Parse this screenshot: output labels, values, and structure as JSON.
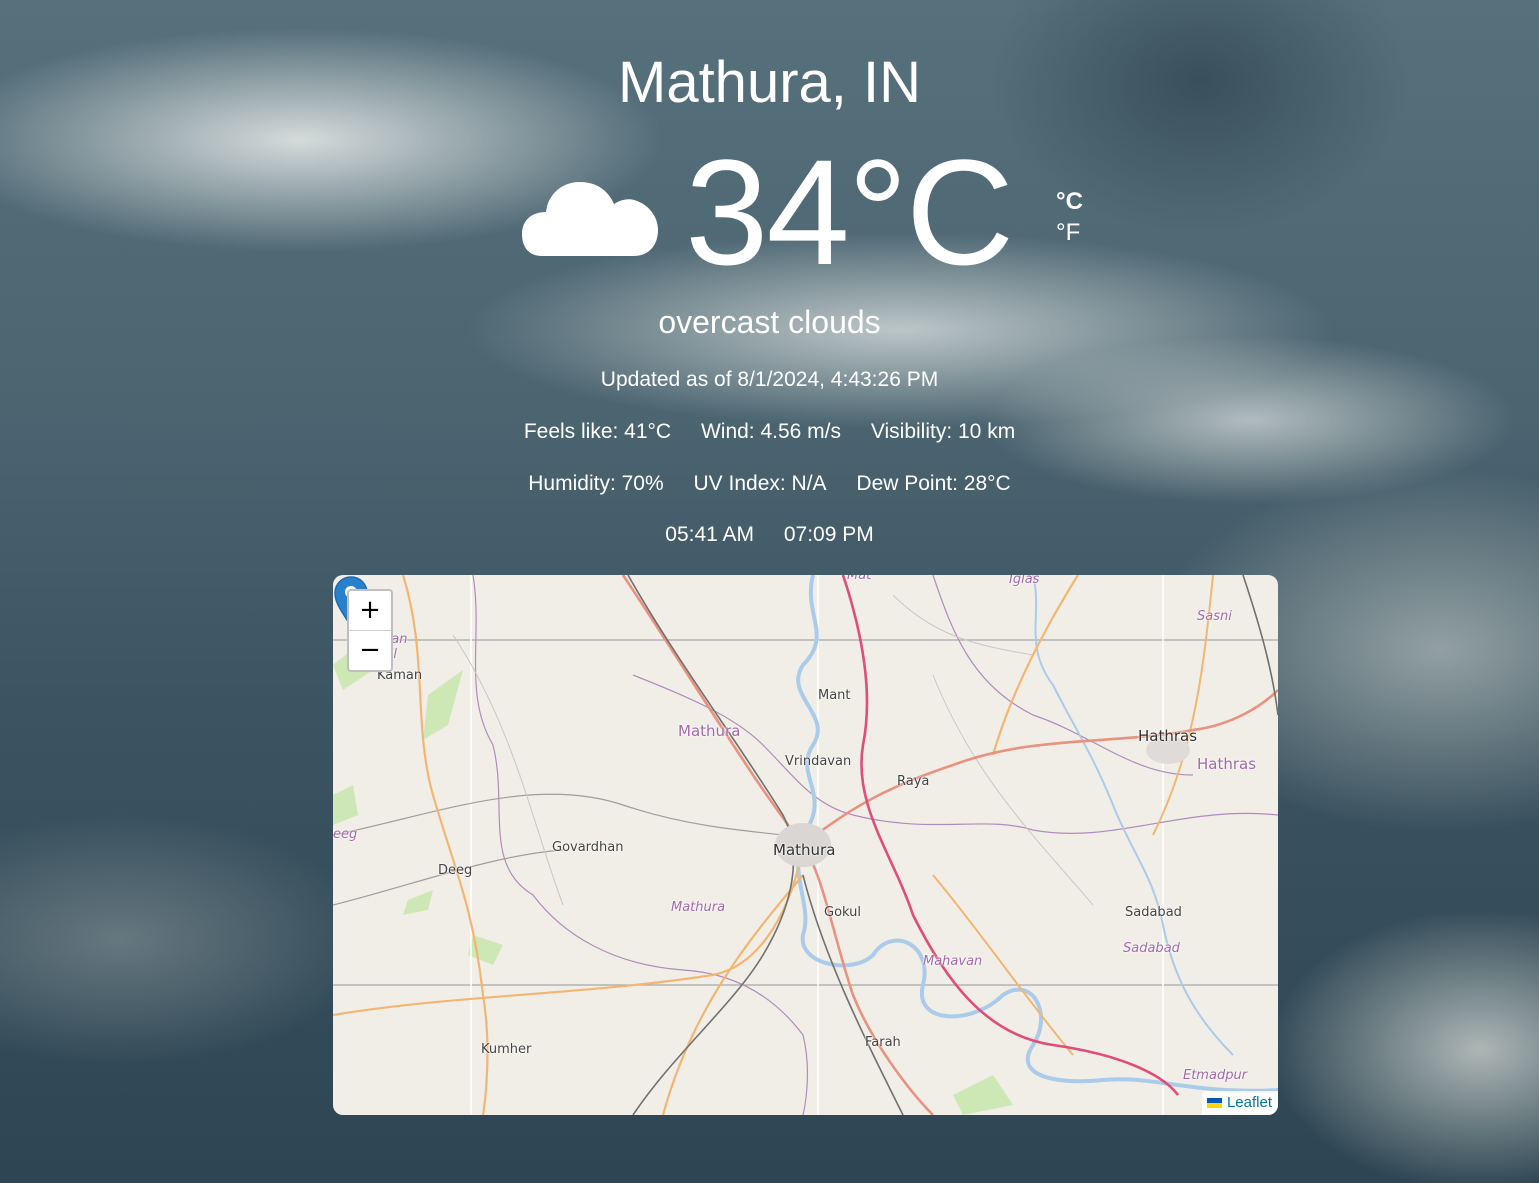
{
  "location": {
    "city": "Mathura, IN"
  },
  "current": {
    "icon": "cloud-icon",
    "temperature": "34°C",
    "description": "overcast clouds",
    "updated": "Updated as of 8/1/2024, 4:43:26 PM"
  },
  "units": {
    "celsius": "°C",
    "fahrenheit": "°F",
    "selected": "°C"
  },
  "details": {
    "feels_like": "Feels like: 41°C",
    "wind": "Wind: 4.56 m/s",
    "visibility": "Visibility: 10 km",
    "humidity": "Humidity: 70%",
    "uv_index": "UV Index: N/A",
    "dew_point": "Dew Point: 28°C",
    "sunrise": "05:41 AM",
    "sunset": "07:09 PM"
  },
  "map": {
    "zoom_in": "+",
    "zoom_out": "−",
    "attribution": "Leaflet",
    "places": {
      "mathura": "Mathura",
      "vrindavan": "Vrindavan",
      "mant": "Mant",
      "raya": "Raya",
      "hathras": "Hathras",
      "hathras_district": "Hathras",
      "govardhan": "Govardhan",
      "deeg": "Deeg",
      "kaman": "Kaman",
      "gokul": "Gokul",
      "sadabad": "Sadabad",
      "sadabad_tehsil": "Sadabad",
      "mahavan": "Mahavan",
      "farah": "Farah",
      "kumher": "Kumher",
      "mathura_district": "Mathura",
      "mathura_tehsil": "Mathura",
      "sasni": "Sasni",
      "etmadpur": "Etmadpur",
      "iglas": "Iglas",
      "mat": "Mat",
      "kaman_tehsil": "nan",
      "tehsil_fragment": "sil",
      "deeg_fragment": "eeg"
    }
  }
}
